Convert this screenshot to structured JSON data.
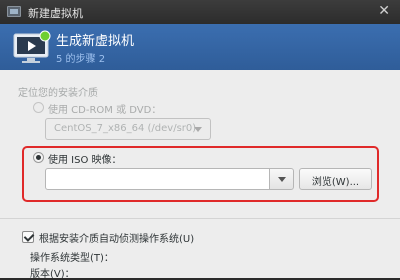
{
  "window": {
    "title": "新建虚拟机",
    "close_glyph": "✕"
  },
  "header": {
    "title": "生成新虚拟机",
    "step": "5 的步骤 2"
  },
  "install_media": {
    "section_title": "定位您的安装介质",
    "cdrom_option": "使用 CD-ROM 或 DVD：",
    "cdrom_selected": "CentOS_7_x86_64 (/dev/sr0)",
    "iso_option": "使用 ISO 映像：",
    "iso_path": "",
    "browse_label": "浏览(W)..."
  },
  "os_detect": {
    "checkbox_label": "根据安装介质自动侦测操作系统(U)",
    "checked": true,
    "os_type_label": "操作系统类型(T)：",
    "version_label": "版本(V)："
  },
  "colors": {
    "header_blue": "#2f5d99",
    "highlight_red": "#e02a2a",
    "window_bg": "#ededed"
  }
}
